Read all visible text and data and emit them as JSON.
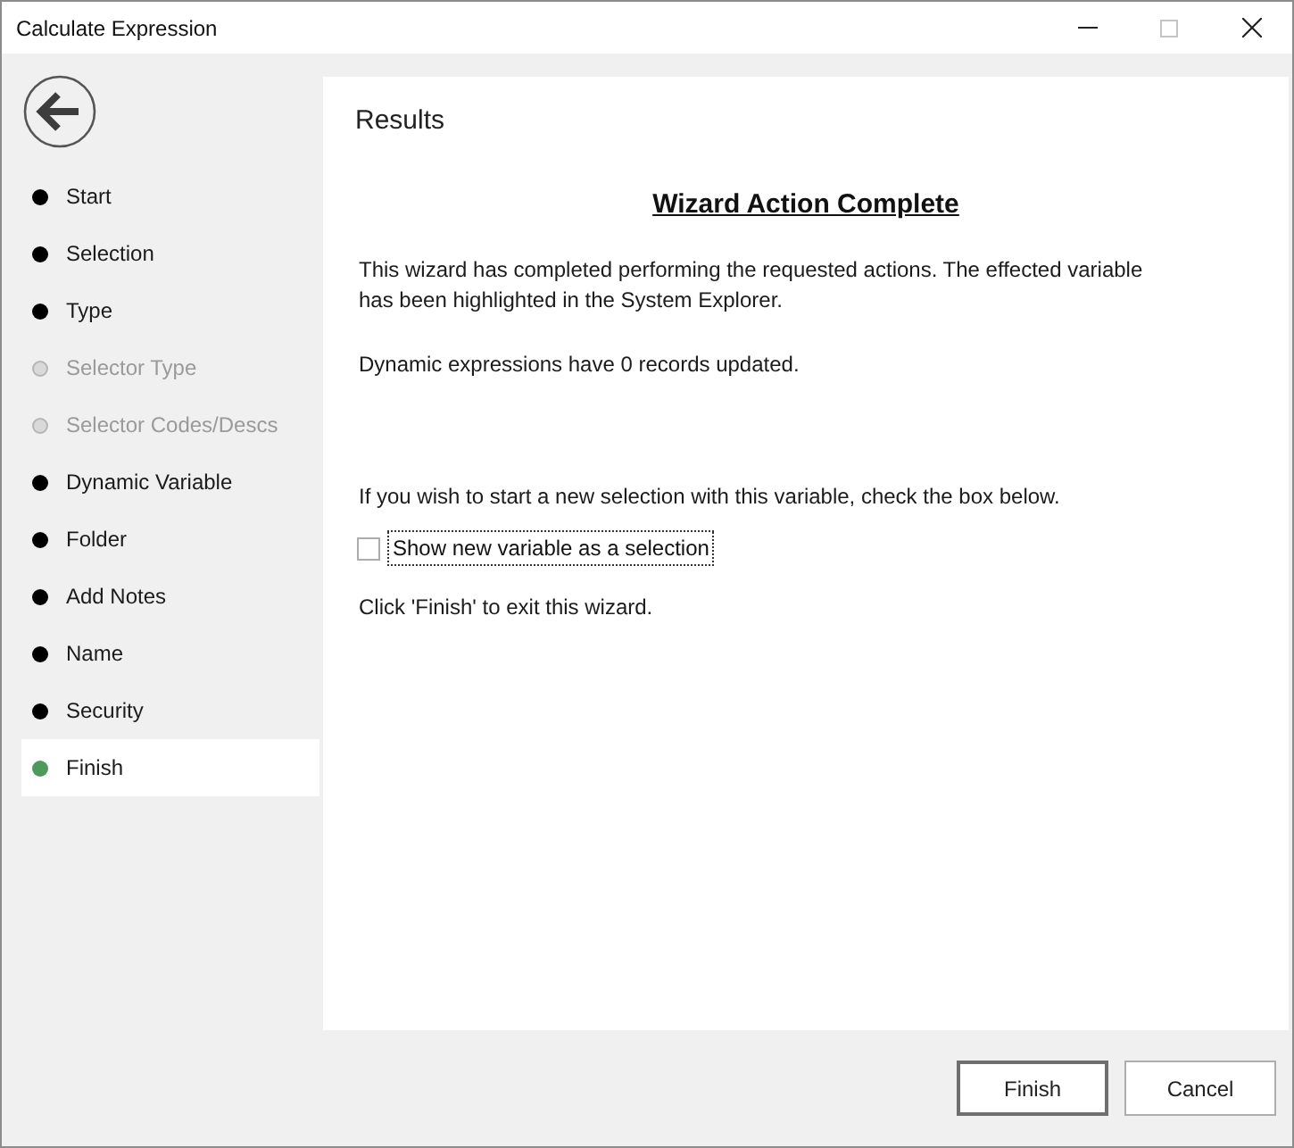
{
  "window": {
    "title": "Calculate Expression",
    "controls": [
      {
        "kind": "minimize",
        "disabled": false
      },
      {
        "kind": "maximize",
        "disabled": true
      },
      {
        "kind": "close",
        "disabled": false
      }
    ]
  },
  "sidebar": {
    "steps": [
      {
        "label": "Start",
        "disabled": false,
        "selected": false
      },
      {
        "label": "Selection",
        "disabled": false,
        "selected": false
      },
      {
        "label": "Type",
        "disabled": false,
        "selected": false
      },
      {
        "label": "Selector Type",
        "disabled": true,
        "selected": false
      },
      {
        "label": "Selector Codes/Descs",
        "disabled": true,
        "selected": false
      },
      {
        "label": "Dynamic Variable",
        "disabled": false,
        "selected": false
      },
      {
        "label": "Folder",
        "disabled": false,
        "selected": false
      },
      {
        "label": "Add Notes",
        "disabled": false,
        "selected": false
      },
      {
        "label": "Name",
        "disabled": false,
        "selected": false
      },
      {
        "label": "Security",
        "disabled": false,
        "selected": false
      },
      {
        "label": "Finish",
        "disabled": false,
        "selected": true
      }
    ]
  },
  "content": {
    "title": "Results",
    "heading": "Wizard Action Complete",
    "messages": [
      "This wizard has completed performing the requested actions. The effected variable has been highlighted in the System Explorer.",
      "Dynamic expressions have 0 records updated."
    ],
    "prompt": "If you wish to start a new selection with this variable, check the box below.",
    "option": {
      "label": "Show new variable as a selection",
      "checked": false,
      "focused": true
    },
    "exit_hint": "Click 'Finish' to exit this wizard."
  },
  "buttons": [
    {
      "label": "Finish",
      "default": true
    },
    {
      "label": "Cancel",
      "default": false
    }
  ]
}
